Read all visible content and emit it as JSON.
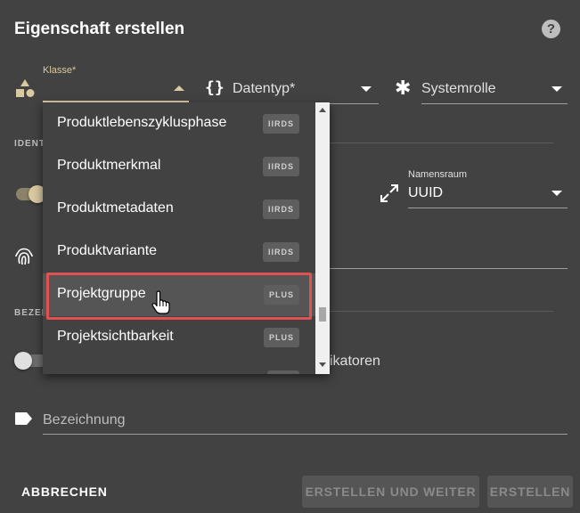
{
  "dialog": {
    "title": "Eigenschaft erstellen",
    "help_icon": "?"
  },
  "fields": {
    "klasse": {
      "label": "Klasse*",
      "value": "",
      "icon": "shapes-icon"
    },
    "datentyp": {
      "placeholder": "Datentyp*",
      "icon": "curly-braces-icon",
      "icon_glyph": "{}"
    },
    "systemrolle": {
      "placeholder": "Systemrolle",
      "icon": "asterisk-icon",
      "icon_glyph": "✱"
    },
    "namensraum": {
      "label": "Namensraum",
      "value": "UUID",
      "icon": "expand-arrows-icon"
    },
    "identifikatoren_partial": "ikatoren",
    "bezeichnung": {
      "placeholder": "Bezeichnung",
      "icon": "label-tag-icon"
    }
  },
  "sections": {
    "identifikation_partial": "IDENT",
    "bezeichnung_partial": "BEZEI"
  },
  "dropdown": {
    "items": [
      {
        "label": "Produktlebenszyklusphase",
        "badge": "IIRDS"
      },
      {
        "label": "Produktmerkmal",
        "badge": "IIRDS"
      },
      {
        "label": "Produktmetadaten",
        "badge": "IIRDS"
      },
      {
        "label": "Produktvariante",
        "badge": "IIRDS"
      },
      {
        "label": "Projektgruppe",
        "badge": "PLUS"
      },
      {
        "label": "Projektsichtbarkeit",
        "badge": "PLUS"
      }
    ],
    "hovered_index": 4
  },
  "actions": {
    "cancel_label": "ABBRECHEN",
    "create_and_continue_label": "ERSTELLEN UND WEITER",
    "create_label": "ERSTELLEN"
  },
  "colors": {
    "background": "#424242",
    "accent": "#d9c9a0",
    "highlight": "#e05252"
  }
}
